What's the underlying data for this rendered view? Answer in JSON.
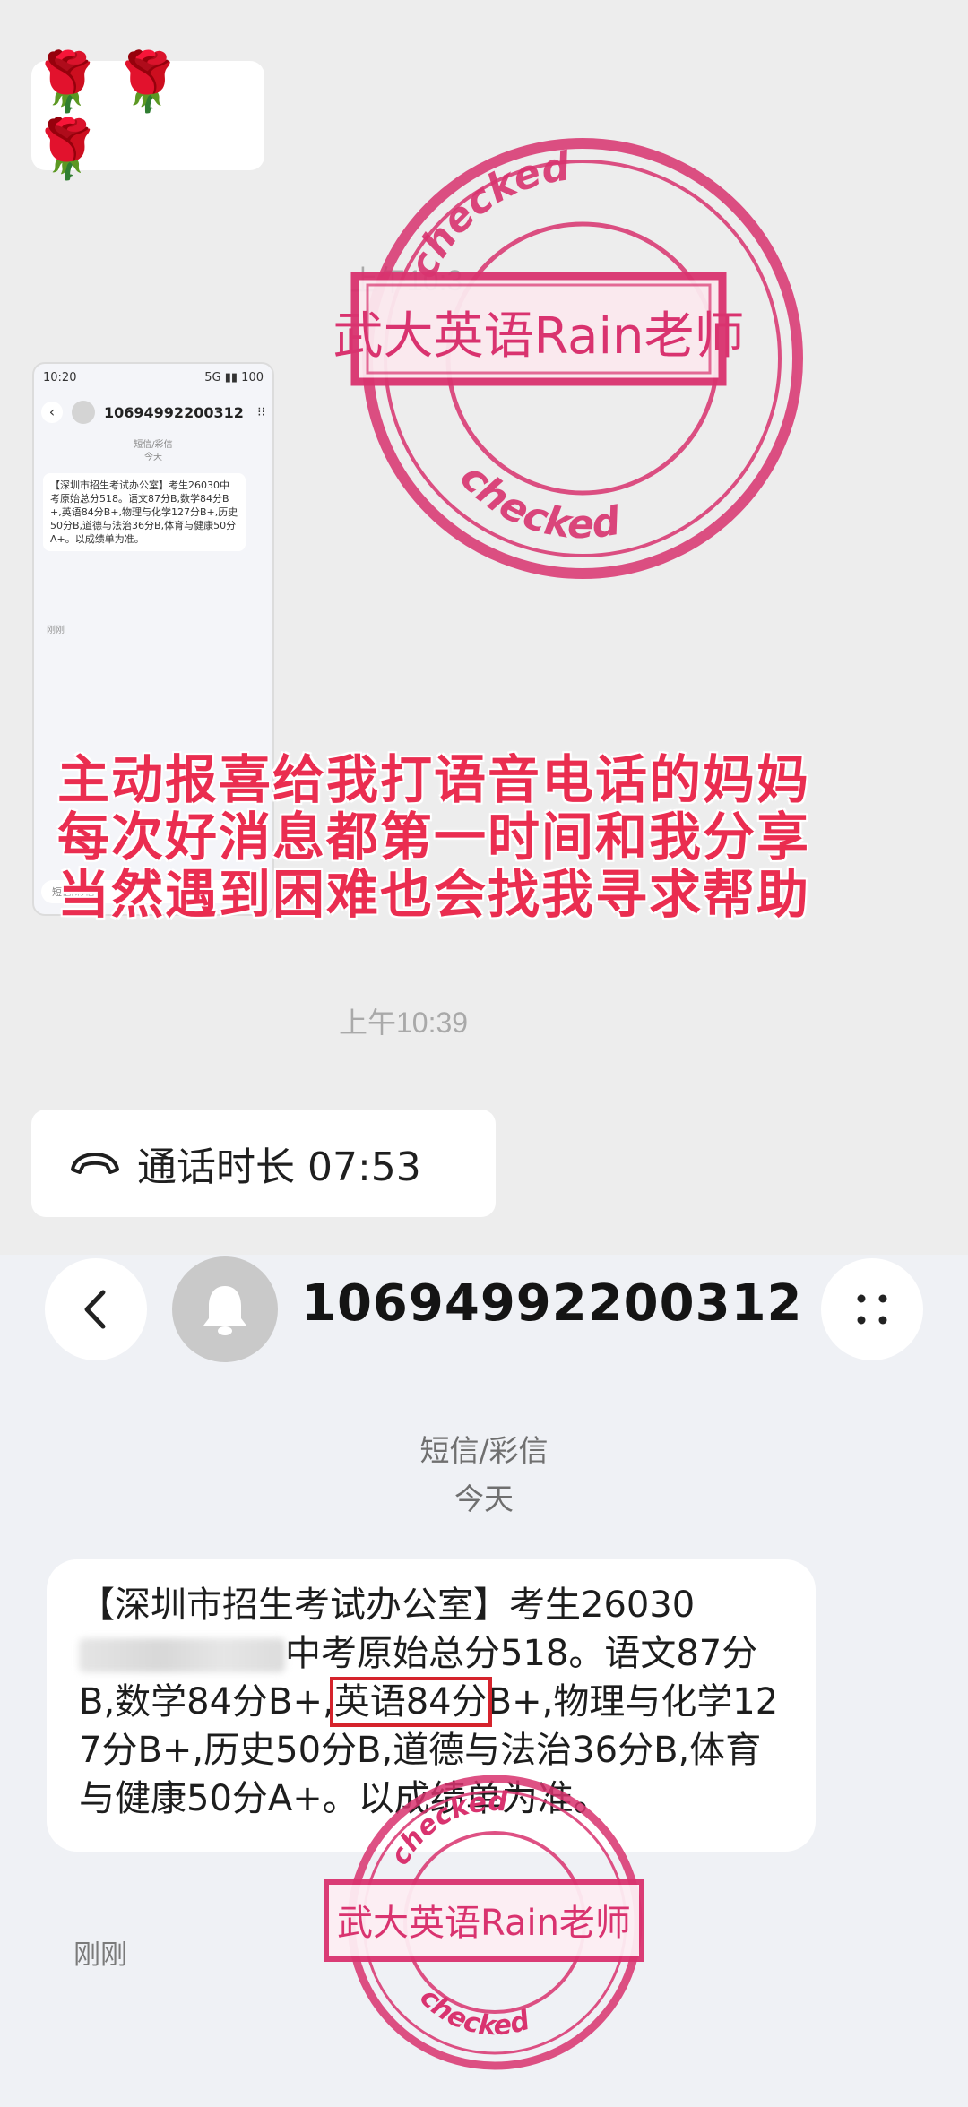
{
  "chat": {
    "roses": "🌹🌹🌹",
    "timestamp_1": "上午10:3",
    "timestamp_2": "上午10:39",
    "call": {
      "label": "通话时长 07:53",
      "icon": "phone-hangup-icon"
    },
    "thumbnail": {
      "status_time": "10:20",
      "status_right": "5G ▮▮ 100",
      "number": "10694992200312",
      "sub_type": "短信/彩信",
      "sub_day": "今天",
      "message": "【深圳市招生考试办公室】考生26030中考原始总分518。语文87分B,数学84分B+,英语84分B+,物理与化学127分B+,历史50分B,道德与法治36分B,体育与健康50分A+。以成绩单为准。",
      "just_now": "刚刚",
      "input_placeholder": "短信/彩信"
    },
    "overlay_lines": [
      "主动报喜给我打语音电话的妈妈",
      "每次好消息都第一时间和我分享",
      "当然遇到困难也会找我寻求帮助"
    ]
  },
  "stamp": {
    "name": "武大英语Rain老师",
    "ring_text": "checked",
    "color": "#d9336f"
  },
  "sms": {
    "header": {
      "back_icon": "chevron-left-icon",
      "avatar_icon": "bell-icon",
      "number": "10694992200312",
      "more_icon": "grid-dots-icon"
    },
    "type_label": "短信/彩信",
    "day_label": "今天",
    "message": {
      "line1_pre": "【深圳市招生考试办公室】考生26030",
      "line2_post": "中考原始总分518。语文87",
      "part3_pre": "分B,数学84分B+,",
      "highlight": "英语84分",
      "part3_post": "B+,物理与化学127分B+,历史50分B,道德与法治36分B,体育与健康50分A+。以成绩单为准。"
    },
    "time_label": "刚刚"
  }
}
